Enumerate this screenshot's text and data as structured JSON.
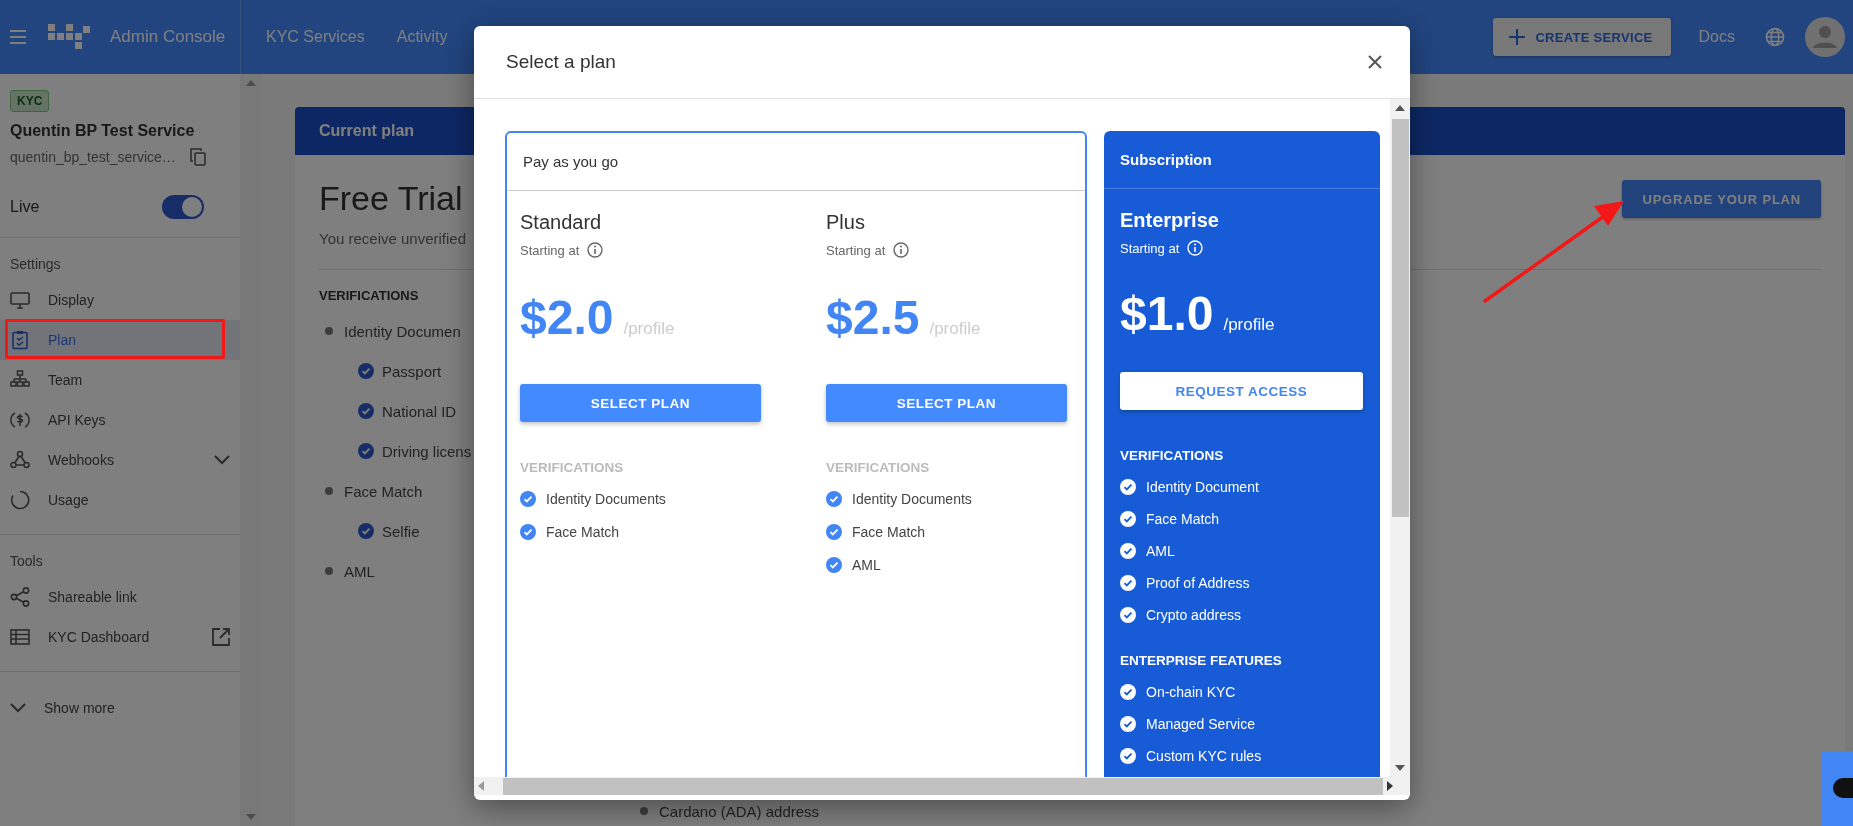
{
  "topbar": {
    "product": "Admin Console",
    "nav": [
      {
        "label": "KYC Services"
      },
      {
        "label": "Activity"
      }
    ],
    "create_button": "CREATE SERVICE",
    "docs": "Docs"
  },
  "sidebar": {
    "badge": "KYC",
    "service_name": "Quentin BP Test Service",
    "service_id": "quentin_bp_test_service…",
    "live": {
      "label": "Live",
      "on": true
    },
    "sections": [
      {
        "title": "Settings",
        "items": [
          {
            "label": "Display",
            "kind": "link",
            "selected": false
          },
          {
            "label": "Plan",
            "kind": "link",
            "selected": true
          },
          {
            "label": "Team",
            "kind": "link",
            "selected": false
          },
          {
            "label": "API Keys",
            "kind": "link",
            "selected": false
          },
          {
            "label": "Webhooks",
            "kind": "group",
            "selected": false
          },
          {
            "label": "Usage",
            "kind": "link",
            "selected": false
          }
        ]
      },
      {
        "title": "Tools",
        "items": [
          {
            "label": "Shareable link",
            "kind": "link",
            "selected": false
          },
          {
            "label": "KYC Dashboard",
            "kind": "external",
            "selected": false
          }
        ]
      }
    ],
    "show_more": "Show more"
  },
  "current_plan": {
    "card_title": "Current plan",
    "plan_name": "Free Trial",
    "description": "You receive unverified",
    "verifications_heading": "VERIFICATIONS",
    "verifications": [
      {
        "label": "Identity Documen",
        "children": [
          {
            "label": "Passport"
          },
          {
            "label": "National ID"
          },
          {
            "label": "Driving licens"
          }
        ]
      },
      {
        "label": "Face Match",
        "children": [
          {
            "label": "Selfie"
          }
        ]
      },
      {
        "label": "AML"
      }
    ],
    "lower_item": "Cardano (ADA) address",
    "upgrade_button": "UPGRADE YOUR PLAN"
  },
  "modal": {
    "title": "Select a plan",
    "groups": [
      {
        "title": "Pay as you go",
        "kind": "outline",
        "plans": [
          {
            "name": "Standard",
            "starting": "Starting at",
            "price": "$2.0",
            "unit": "/profile",
            "button": "SELECT PLAN",
            "sections": [
              {
                "title": "VERIFICATIONS",
                "items": [
                  "Identity Documents",
                  "Face Match"
                ]
              }
            ]
          },
          {
            "name": "Plus",
            "starting": "Starting at",
            "price": "$2.5",
            "unit": "/profile",
            "button": "SELECT PLAN",
            "sections": [
              {
                "title": "VERIFICATIONS",
                "items": [
                  "Identity Documents",
                  "Face Match",
                  "AML"
                ]
              }
            ]
          }
        ]
      },
      {
        "title": "Subscription",
        "kind": "filled",
        "plans": [
          {
            "name": "Enterprise",
            "starting": "Starting at",
            "price": "$1.0",
            "unit": "/profile",
            "button": "REQUEST ACCESS",
            "sections": [
              {
                "title": "VERIFICATIONS",
                "items": [
                  "Identity Document",
                  "Face Match",
                  "AML",
                  "Proof of Address",
                  "Crypto address"
                ]
              },
              {
                "title": "ENTERPRISE FEATURES",
                "items": [
                  "On-chain KYC",
                  "Managed Service",
                  "Custom KYC rules"
                ]
              }
            ]
          }
        ]
      }
    ]
  }
}
